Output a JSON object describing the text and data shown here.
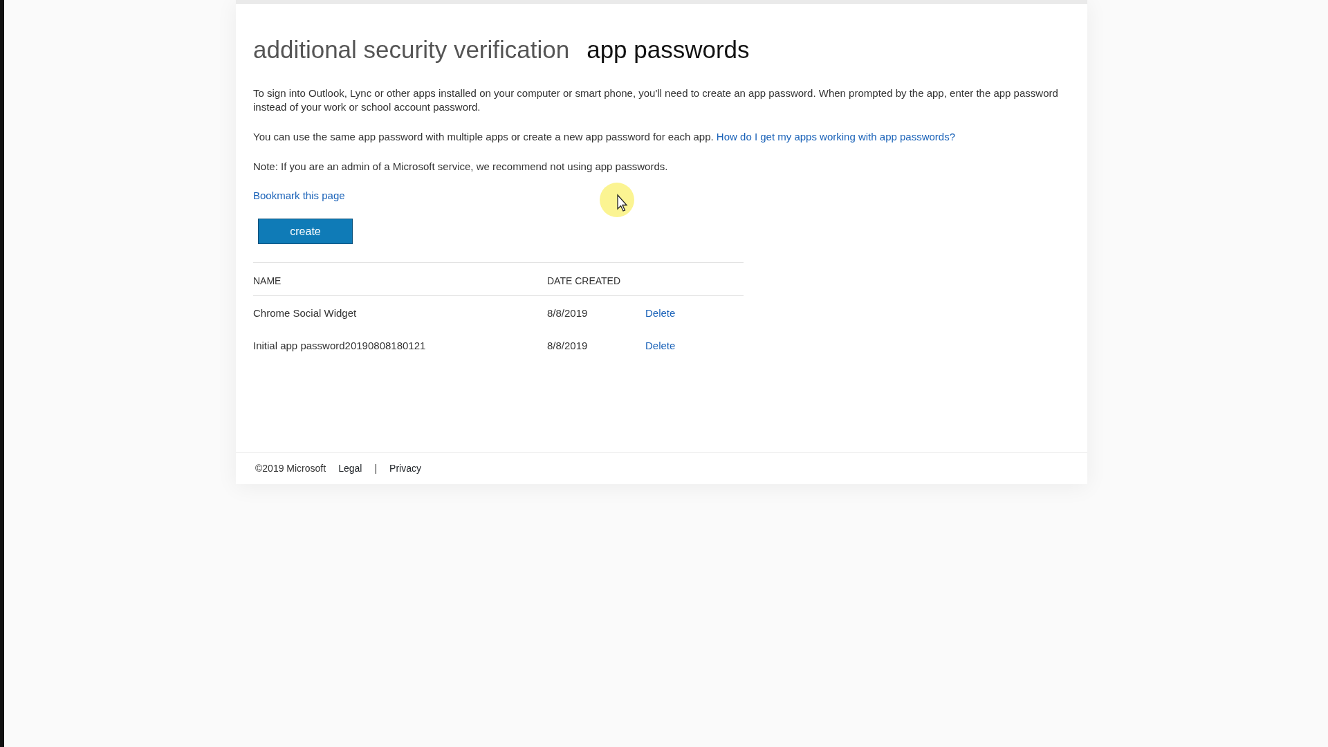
{
  "tabs": [
    {
      "label": "additional security verification",
      "selected": false
    },
    {
      "label": "app passwords",
      "selected": true
    }
  ],
  "paragraphs": [
    {
      "text": "To sign into Outlook, Lync or other apps installed on your computer or smart phone, you'll need to create an app password. When prompted by the app, enter the app password instead of your work or school account password."
    },
    {
      "text": "You can use the same app password with multiple apps or create a new app password for each app.",
      "link": "How do I get my apps working with app passwords?"
    },
    {
      "text": "Note: If you are an admin of a Microsoft service, we recommend not using app passwords."
    }
  ],
  "bookmark_link": "Bookmark this page",
  "create_button": "create",
  "table": {
    "columns": [
      "NAME",
      "DATE CREATED"
    ],
    "rows": [
      {
        "name": "Chrome Social Widget",
        "date": "8/8/2019",
        "action": "Delete"
      },
      {
        "name": "Initial app password20190808180121",
        "date": "8/8/2019",
        "action": "Delete"
      }
    ]
  },
  "footer": {
    "copyright": "©2019 Microsoft",
    "links": [
      "Legal",
      "Privacy"
    ],
    "separator": "|"
  }
}
